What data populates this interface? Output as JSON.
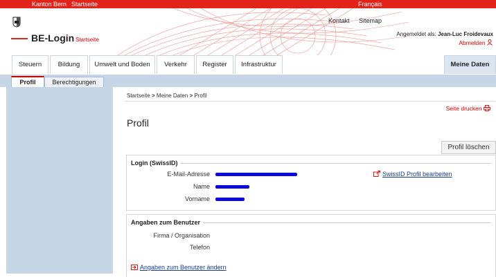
{
  "topbar": {
    "canton": "Kanton Bern",
    "startseite": "Startseite",
    "language": "Français"
  },
  "header": {
    "app_title": "BE-Login",
    "app_subtitle": "Startseite",
    "kontakt": "Kontakt",
    "sitemap": "Sitemap",
    "logged_in_label": "Angemeldet als: ",
    "user_name": "Jean-Luc Froidevaux",
    "logout": "Abmelden"
  },
  "nav": {
    "tabs": [
      "Steuern",
      "Bildung",
      "Umwelt und Boden",
      "Verkehr",
      "Register",
      "Infrastruktur"
    ],
    "active_tab": "Meine Daten"
  },
  "subnav": {
    "tabs": [
      "Profil",
      "Berechtigungen"
    ]
  },
  "breadcrumb": {
    "home": "Startseite",
    "sep": " > ",
    "level1": "Meine Daten",
    "level2": "Profil"
  },
  "page": {
    "print": "Seite drucken",
    "title": "Profil",
    "delete_button": "Profil löschen"
  },
  "login_box": {
    "legend": "Login (SwissID)",
    "fields": [
      {
        "label": "E-Mail-Adresse"
      },
      {
        "label": "Name"
      },
      {
        "label": "Vorname"
      }
    ],
    "edit_link": "SwissID Profil bearbeiten"
  },
  "user_box": {
    "legend": "Angaben zum Benutzer",
    "fields": [
      {
        "label": "Firma / Organisation"
      },
      {
        "label": "Telefon"
      }
    ],
    "edit_link": "Angaben zum Benutzer ändern"
  },
  "colors": {
    "brand_red": "#e2231a",
    "nav_blue": "#c5d6e6",
    "redaction": "#0a0add"
  }
}
